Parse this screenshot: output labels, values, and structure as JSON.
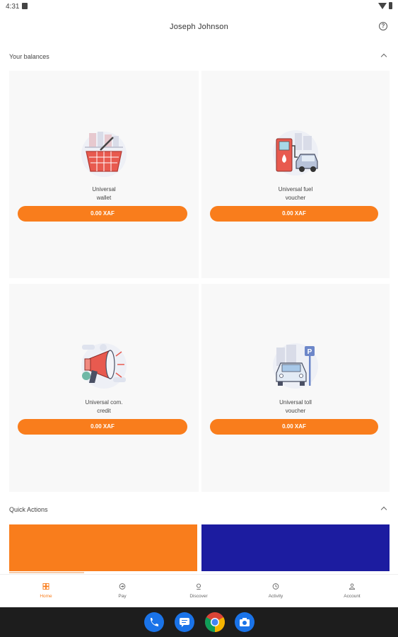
{
  "status_bar": {
    "time": "4:31"
  },
  "header": {
    "title": "Joseph Johnson"
  },
  "balances_section": {
    "title": "Your balances",
    "cards": [
      {
        "label_line1": "Universal",
        "label_line2": "wallet",
        "amount": "0.00 XAF",
        "icon": "shopping-basket-icon"
      },
      {
        "label_line1": "Universal fuel",
        "label_line2": "voucher",
        "amount": "0.00 XAF",
        "icon": "fuel-pump-icon"
      },
      {
        "label_line1": "Universal com.",
        "label_line2": "credit",
        "amount": "0.00 XAF",
        "icon": "megaphone-icon"
      },
      {
        "label_line1": "Universal toll",
        "label_line2": "voucher",
        "amount": "0.00 XAF",
        "icon": "parking-car-icon"
      }
    ]
  },
  "quick_actions": {
    "title": "Quick Actions",
    "tiles": [
      {
        "color": "#f97d1c"
      },
      {
        "color": "#1c1ca0"
      }
    ]
  },
  "bottom_nav": [
    {
      "label": "Home",
      "icon": "home-icon",
      "active": true
    },
    {
      "label": "Pay",
      "icon": "pay-icon",
      "active": false
    },
    {
      "label": "Discover",
      "icon": "discover-icon",
      "active": false
    },
    {
      "label": "Activity",
      "icon": "activity-icon",
      "active": false
    },
    {
      "label": "Account",
      "icon": "account-icon",
      "active": false
    }
  ],
  "dock": [
    {
      "icon": "phone-icon"
    },
    {
      "icon": "messages-icon"
    },
    {
      "icon": "chrome-icon"
    },
    {
      "icon": "camera-icon"
    }
  ],
  "colors": {
    "accent": "#f97d1c",
    "secondary": "#1c1ca0",
    "card_bg": "#f8f8f8"
  }
}
